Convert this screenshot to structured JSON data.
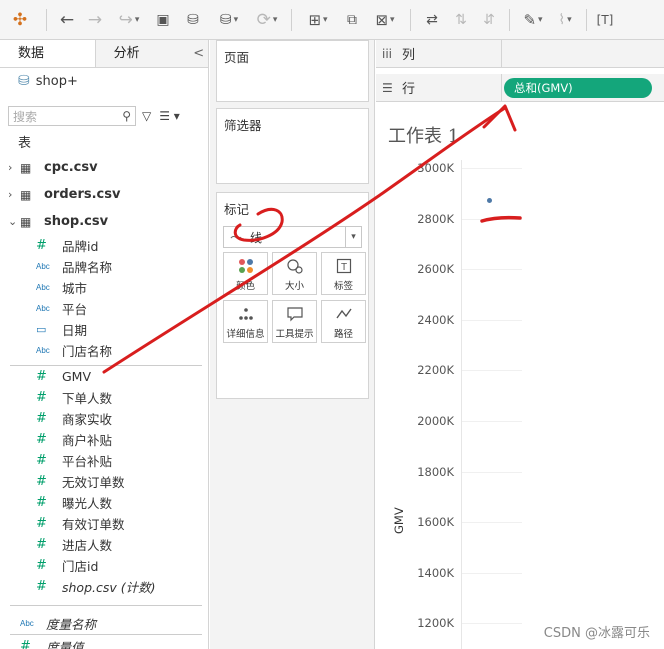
{
  "left": {
    "tabs": [
      "数据",
      "分析"
    ],
    "collapse": "<",
    "datasource": "shop+",
    "search_placeholder": "搜索",
    "section_tables": "表",
    "tables": [
      {
        "name": "cpc.csv",
        "expanded": false
      },
      {
        "name": "orders.csv",
        "expanded": false
      },
      {
        "name": "shop.csv",
        "expanded": true
      }
    ],
    "dimensions": [
      {
        "type": "#",
        "name": "品牌id"
      },
      {
        "type": "Abc",
        "name": "品牌名称"
      },
      {
        "type": "Abc",
        "name": "城市"
      },
      {
        "type": "Abc",
        "name": "平台"
      },
      {
        "type": "date",
        "name": "日期"
      },
      {
        "type": "Abc",
        "name": "门店名称"
      }
    ],
    "measures": [
      {
        "type": "#",
        "name": "GMV"
      },
      {
        "type": "#",
        "name": "下单人数"
      },
      {
        "type": "#",
        "name": "商家实收"
      },
      {
        "type": "#",
        "name": "商户补贴"
      },
      {
        "type": "#",
        "name": "平台补贴"
      },
      {
        "type": "#",
        "name": "无效订单数"
      },
      {
        "type": "#",
        "name": "曝光人数"
      },
      {
        "type": "#",
        "name": "有效订单数"
      },
      {
        "type": "#",
        "name": "进店人数"
      },
      {
        "type": "#",
        "name": "门店id"
      },
      {
        "type": "#",
        "name": "shop.csv (计数)"
      }
    ],
    "bottom": [
      {
        "type": "Abc",
        "name": "度量名称"
      },
      {
        "type": "#",
        "name": "度量值"
      }
    ]
  },
  "middle": {
    "pages_title": "页面",
    "filters_title": "筛选器",
    "marks_title": "标记",
    "mark_type": "线",
    "mark_buttons": [
      "颜色",
      "大小",
      "标签",
      "详细信息",
      "工具提示",
      "路径"
    ]
  },
  "shelves": {
    "columns_label": "列",
    "rows_label": "行",
    "rows_pill": "总和(GMV)"
  },
  "view": {
    "title": "工作表 1",
    "y_axis_label": "GMV",
    "y_ticks": [
      "3000K",
      "2800K",
      "2600K",
      "2400K",
      "2200K",
      "2000K",
      "1800K",
      "1600K",
      "1400K",
      "1200K"
    ]
  },
  "chart_data": {
    "type": "line",
    "y_label": "GMV",
    "y_ticks": [
      3000,
      2800,
      2600,
      2400,
      2200,
      2000,
      1800,
      1600,
      1400,
      1200
    ],
    "y_unit": "K",
    "series": [
      {
        "values": [
          2870
        ]
      }
    ]
  },
  "watermark": "CSDN @冰露可乐",
  "annotation_color": "#d81e1e"
}
